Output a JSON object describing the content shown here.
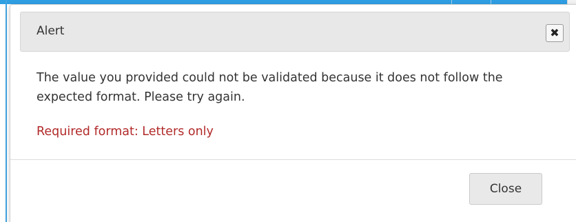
{
  "dialog": {
    "title": "Alert",
    "close_icon_glyph": "✖",
    "message": "The value you provided could not be validated because it does not follow the expected format. Please try again.",
    "required_format": "Required format: Letters only",
    "close_button_label": "Close"
  },
  "colors": {
    "error_text": "#b22a2a",
    "accent_blue": "#2f9fe3",
    "titlebar_bg": "#e8e8e8"
  }
}
